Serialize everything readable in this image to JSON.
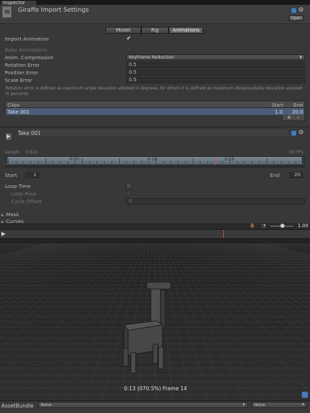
{
  "window_tab": {
    "label": "Inspector"
  },
  "header": {
    "title": "Giraffe Import Settings",
    "open_label": "Open",
    "help_icon": "help-book-icon",
    "settings_icon": "gear-icon"
  },
  "tabs": [
    {
      "label": "Model",
      "active": false
    },
    {
      "label": "Rig",
      "active": false
    },
    {
      "label": "Animations",
      "active": true
    }
  ],
  "import_animation": {
    "label": "Import Animation",
    "checked": true,
    "check_glyph": "✔"
  },
  "bake_animations": {
    "label": "Bake Animations",
    "enabled": false
  },
  "anim_compression": {
    "label": "Anim. Compression",
    "value": "Keyframe Reduction"
  },
  "rotation_error": {
    "label": "Rotation Error",
    "value": "0.5"
  },
  "position_error": {
    "label": "Position Error",
    "value": "0.5"
  },
  "scale_error": {
    "label": "Scale Error",
    "value": "0.5"
  },
  "info_text": "Rotation error is defined as maximum angle deviation allowed in degrees, for others it is defined as maximum distance/delta deviation allowed in percents",
  "clips": {
    "headers": {
      "name": "Clips",
      "start": "Start",
      "end": "End"
    },
    "rows": [
      {
        "name": "Take 001",
        "start": "1.0",
        "end": "20.0"
      }
    ],
    "add_label": "+",
    "remove_label": "–"
  },
  "take": {
    "name": "Take 001",
    "length_label": "Length",
    "length_value": "0.633",
    "fps": "30 FPS",
    "timeline_labels": [
      "0:05",
      "0:10",
      "0:15"
    ],
    "start_label": "Start",
    "start_value": "1",
    "end_label": "End",
    "end_value": "20"
  },
  "loop_time": {
    "label": "Loop Time",
    "checked": false
  },
  "loop_pose": {
    "label": "Loop Pose",
    "enabled": false
  },
  "cycle_offset": {
    "label": "Cycle Offset",
    "value": "0"
  },
  "foldouts": [
    {
      "label": "Mask"
    },
    {
      "label": "Curves"
    }
  ],
  "preview_toolbar": {
    "speed_value": "1.00"
  },
  "preview": {
    "frame_label": "0:13 (070.5%) Frame 14",
    "play_glyph": "▶"
  },
  "asset_bundle": {
    "label": "AssetBundle",
    "bundle_value": "None",
    "variant_value": "None"
  },
  "colors": {
    "panel_bg": "#383838",
    "selected_row": "#4d5d79",
    "timeline": "#6f7c88",
    "playhead": "#e0453e",
    "scene_bg": "#1d1d1d"
  }
}
